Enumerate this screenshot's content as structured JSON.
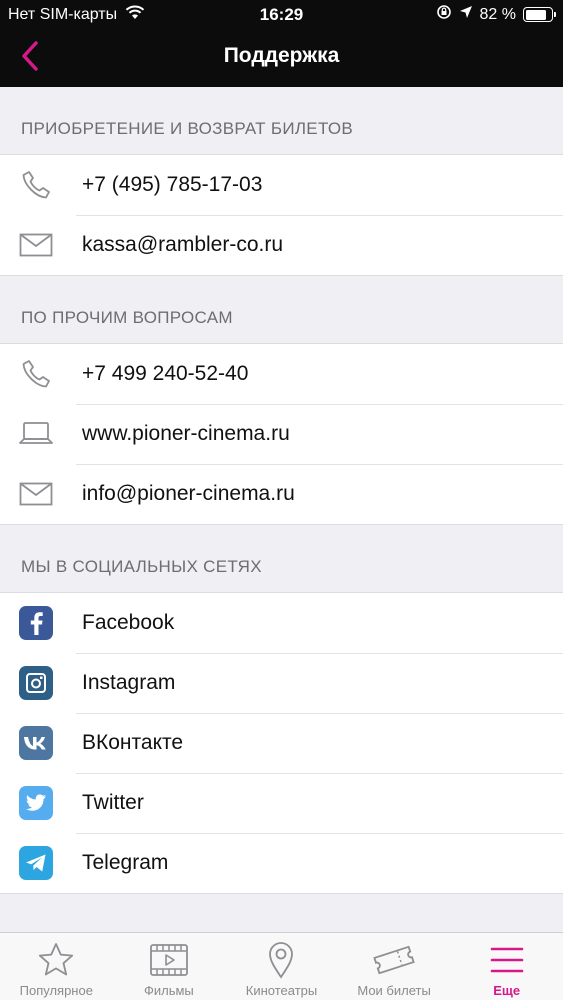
{
  "status_bar": {
    "carrier": "Нет SIM-карты",
    "time": "16:29",
    "battery_percent": "82 %",
    "battery_level": 0.82
  },
  "nav": {
    "title": "Поддержка",
    "back_icon": "chevron-left-icon"
  },
  "colors": {
    "accent": "#d6198a",
    "facebook": "#3b5998",
    "instagram": "#2e5f86",
    "vk": "#4d76a1",
    "twitter": "#55acee",
    "telegram": "#2ca5e0"
  },
  "sections": {
    "tickets": {
      "header": "ПРИОБРЕТЕНИЕ И ВОЗВРАТ БИЛЕТОВ",
      "items": [
        {
          "icon": "phone-icon",
          "label": "+7 (495) 785-17-03"
        },
        {
          "icon": "mail-icon",
          "label": "kassa@rambler-co.ru"
        }
      ]
    },
    "other": {
      "header": "ПО ПРОЧИМ ВОПРОСАМ",
      "items": [
        {
          "icon": "phone-icon",
          "label": "+7 499 240-52-40"
        },
        {
          "icon": "laptop-icon",
          "label": "www.pioner-cinema.ru"
        },
        {
          "icon": "mail-icon",
          "label": "info@pioner-cinema.ru"
        }
      ]
    },
    "social": {
      "header": "МЫ В СОЦИАЛЬНЫХ СЕТЯХ",
      "items": [
        {
          "icon": "facebook-icon",
          "label": "Facebook"
        },
        {
          "icon": "instagram-icon",
          "label": "Instagram"
        },
        {
          "icon": "vk-icon",
          "label": "ВКонтакте"
        },
        {
          "icon": "twitter-icon",
          "label": "Twitter"
        },
        {
          "icon": "telegram-icon",
          "label": "Telegram"
        }
      ]
    }
  },
  "tabbar": {
    "tabs": [
      {
        "icon": "star-icon",
        "label": "Популярное"
      },
      {
        "icon": "film-icon",
        "label": "Фильмы"
      },
      {
        "icon": "map-pin-icon",
        "label": "Кинотеатры"
      },
      {
        "icon": "ticket-icon",
        "label": "Мои билеты"
      },
      {
        "icon": "menu-icon",
        "label": "Еще",
        "active": true
      }
    ]
  }
}
